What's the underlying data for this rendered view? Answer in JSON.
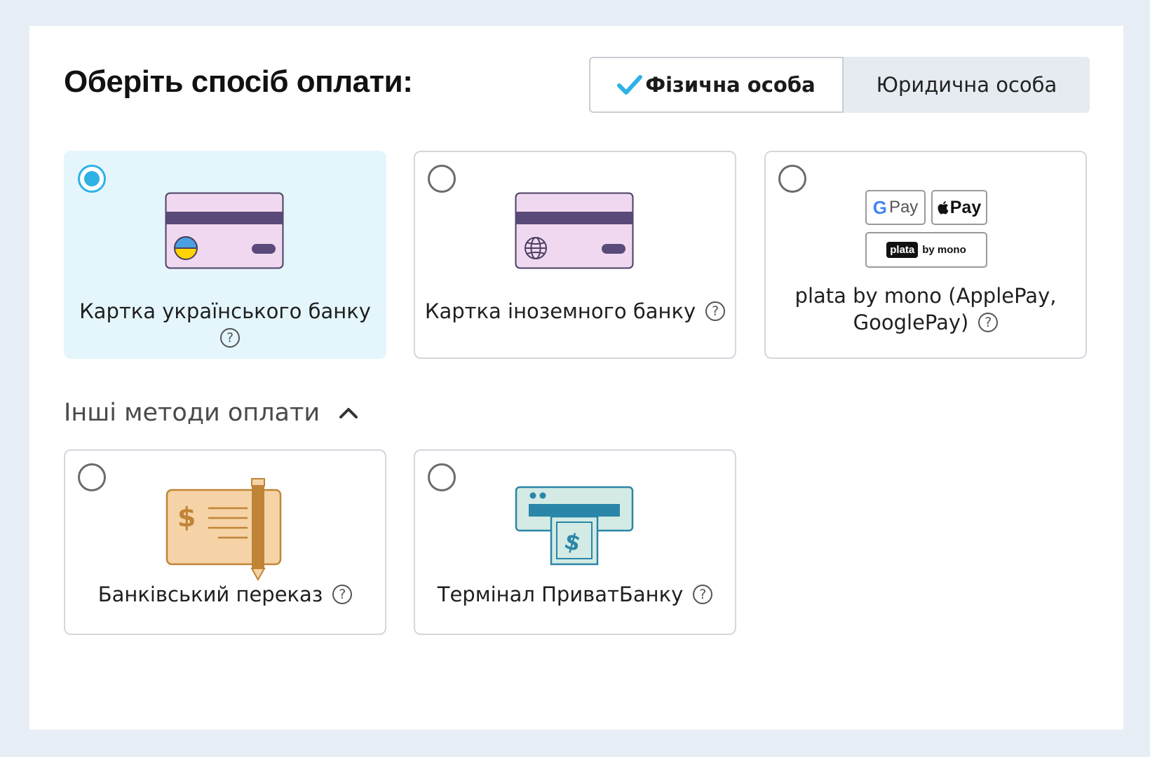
{
  "header": {
    "title": "Оберіть спосіб оплати:"
  },
  "payer_type": {
    "options": [
      {
        "label": "Фізична особа",
        "selected": true
      },
      {
        "label": "Юридична особа",
        "selected": false
      }
    ]
  },
  "methods": [
    {
      "label": "Картка українського банку",
      "selected": true,
      "icon": "ukrainian-card-icon"
    },
    {
      "label": "Картка іноземного банку",
      "selected": false,
      "icon": "foreign-card-icon"
    },
    {
      "label_line1": "plata by mono (ApplePay,",
      "label_line2": "GooglePay)",
      "selected": false,
      "icon": "wallet-badges",
      "badges": {
        "gpay_g": "G",
        "gpay": "Pay",
        "apay": "Pay",
        "plata": "plata",
        "bymono": "by mono"
      }
    }
  ],
  "other_methods": {
    "toggle_label": "Інші методи оплати",
    "expanded": true,
    "items": [
      {
        "label": "Банківський переказ",
        "selected": false,
        "icon": "bank-check-icon"
      },
      {
        "label": "Термінал ПриватБанку",
        "selected": false,
        "icon": "atm-cash-icon"
      }
    ]
  },
  "help_glyph": "?",
  "colors": {
    "accent": "#2fb1e6",
    "selected_card_bg": "#e4f6fc",
    "card_pink": "#f0d9f0",
    "card_stripe": "#5a4a7a",
    "check_orange": "#f5d3a6",
    "check_brown": "#c08437",
    "atm_teal": "#2a86a8",
    "atm_mint": "#d3ebe4"
  }
}
